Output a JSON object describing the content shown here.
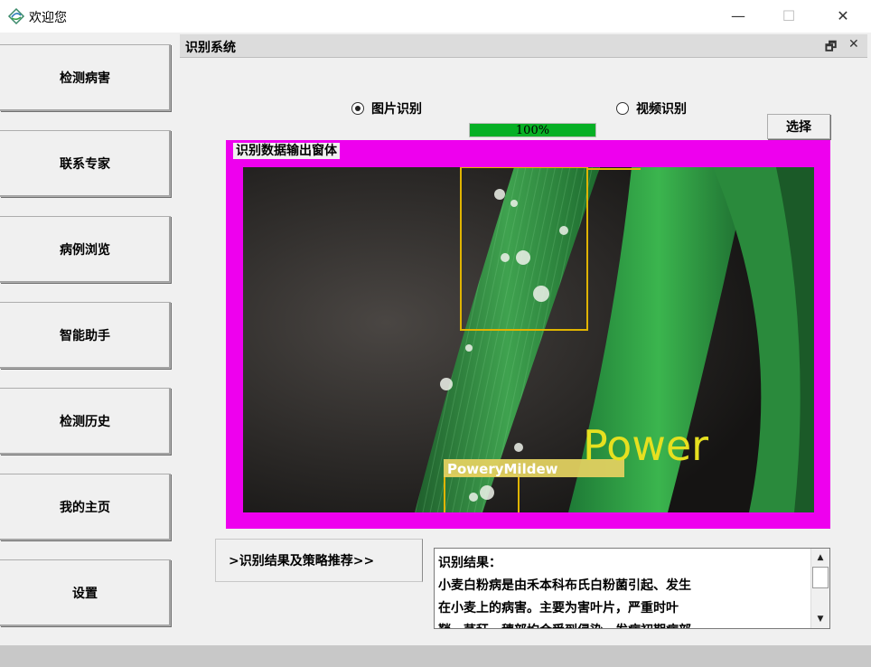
{
  "window": {
    "title": "欢迎您",
    "minimize": "—",
    "maximize": "☐",
    "close": "✕"
  },
  "sidebar": {
    "items": [
      {
        "label": "检测病害"
      },
      {
        "label": "联系专家"
      },
      {
        "label": "病例浏览"
      },
      {
        "label": "智能助手"
      },
      {
        "label": "检测历史"
      },
      {
        "label": "我的主页"
      },
      {
        "label": "设置"
      }
    ]
  },
  "subwindow": {
    "title": "识别系统",
    "restore": "🗗",
    "close": "✕"
  },
  "mode": {
    "image_label": "图片识别",
    "video_label": "视频识别",
    "selected": "image"
  },
  "progress": {
    "value": 100,
    "text": "100%",
    "color": "#06b025"
  },
  "select_button": {
    "label": "选择"
  },
  "output": {
    "group_label": "识别数据输出窗体",
    "frame_color": "#ee00ee",
    "box_color": "#e0b400",
    "detection_label": "PoweryMildew",
    "overlay_text": "Power"
  },
  "result": {
    "tab_label": ">识别结果及策略推荐>>",
    "lines": [
      "识别结果：",
      "小麦白粉病是由禾本科布氏白粉菌引起、发生",
      "在小麦上的病害。主要为害叶片，严重时叶",
      "鞘、茎秆、穗部均会受到侵染。发病初期病部"
    ]
  },
  "icons": {
    "app": "app-leaf-icon",
    "scroll_up": "scroll-up-icon",
    "scroll_down": "scroll-down-icon"
  }
}
